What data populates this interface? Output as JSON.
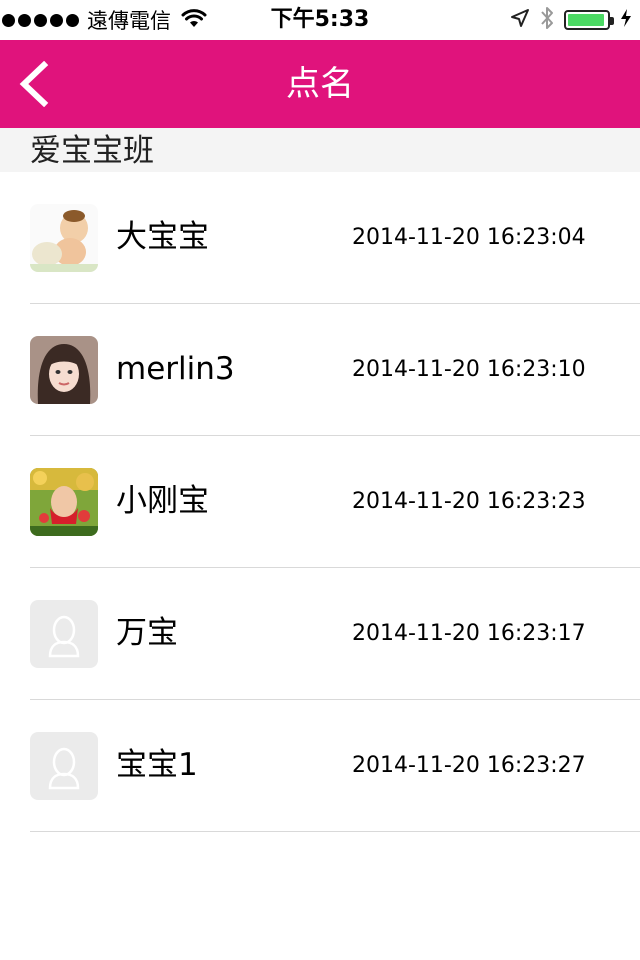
{
  "status_bar": {
    "carrier": "遠傳電信",
    "time": "下午5:33",
    "battery_color": "#4cd964"
  },
  "nav": {
    "title": "点名",
    "back_icon": "chevron-left-icon",
    "bg_color": "#e0137c"
  },
  "section": {
    "title": "爱宝宝班"
  },
  "students": [
    {
      "name": "大宝宝",
      "time": "2014-11-20 16:23:04",
      "avatar": "baby-photo"
    },
    {
      "name": "merlin3",
      "time": "2014-11-20 16:23:10",
      "avatar": "girl-photo"
    },
    {
      "name": "小刚宝",
      "time": "2014-11-20 16:23:23",
      "avatar": "flower-photo"
    },
    {
      "name": "万宝",
      "time": "2014-11-20 16:23:17",
      "avatar": "default-avatar"
    },
    {
      "name": "宝宝1",
      "time": "2014-11-20 16:23:27",
      "avatar": "default-avatar"
    }
  ]
}
